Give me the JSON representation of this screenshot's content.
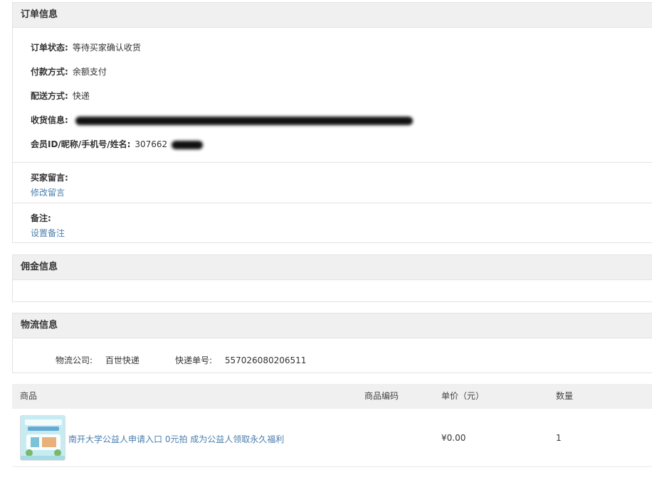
{
  "order_info": {
    "title": "订单信息",
    "status_label": "订单状态:",
    "status_value": "等待买家确认收货",
    "payment_label": "付款方式:",
    "payment_value": "余额支付",
    "delivery_label": "配送方式:",
    "delivery_value": "快递",
    "receiver_label": "收货信息:",
    "member_label": "会员ID/昵称/手机号/姓名:",
    "member_value": "307662",
    "buyer_note_label": "买家留言:",
    "buyer_note_link": "修改留言",
    "remark_label": "备注:",
    "remark_link": "设置备注"
  },
  "commission_info": {
    "title": "佣金信息"
  },
  "logistics_info": {
    "title": "物流信息",
    "company_label": "物流公司:",
    "company_value": "百世快递",
    "tracking_label": "快递单号:",
    "tracking_value": "557026080206511"
  },
  "goods": {
    "headers": [
      "商品",
      "商品编码",
      "单价（元）",
      "数量"
    ],
    "items": [
      {
        "title": "南开大学公益人申请入口 0元拍 成为公益人领取永久福利",
        "code": "",
        "price": "¥0.00",
        "quantity": "1"
      }
    ]
  },
  "colors": {
    "link": "#4a7eae",
    "header_bg": "#f0f0f0",
    "border": "#e2e2e2"
  }
}
